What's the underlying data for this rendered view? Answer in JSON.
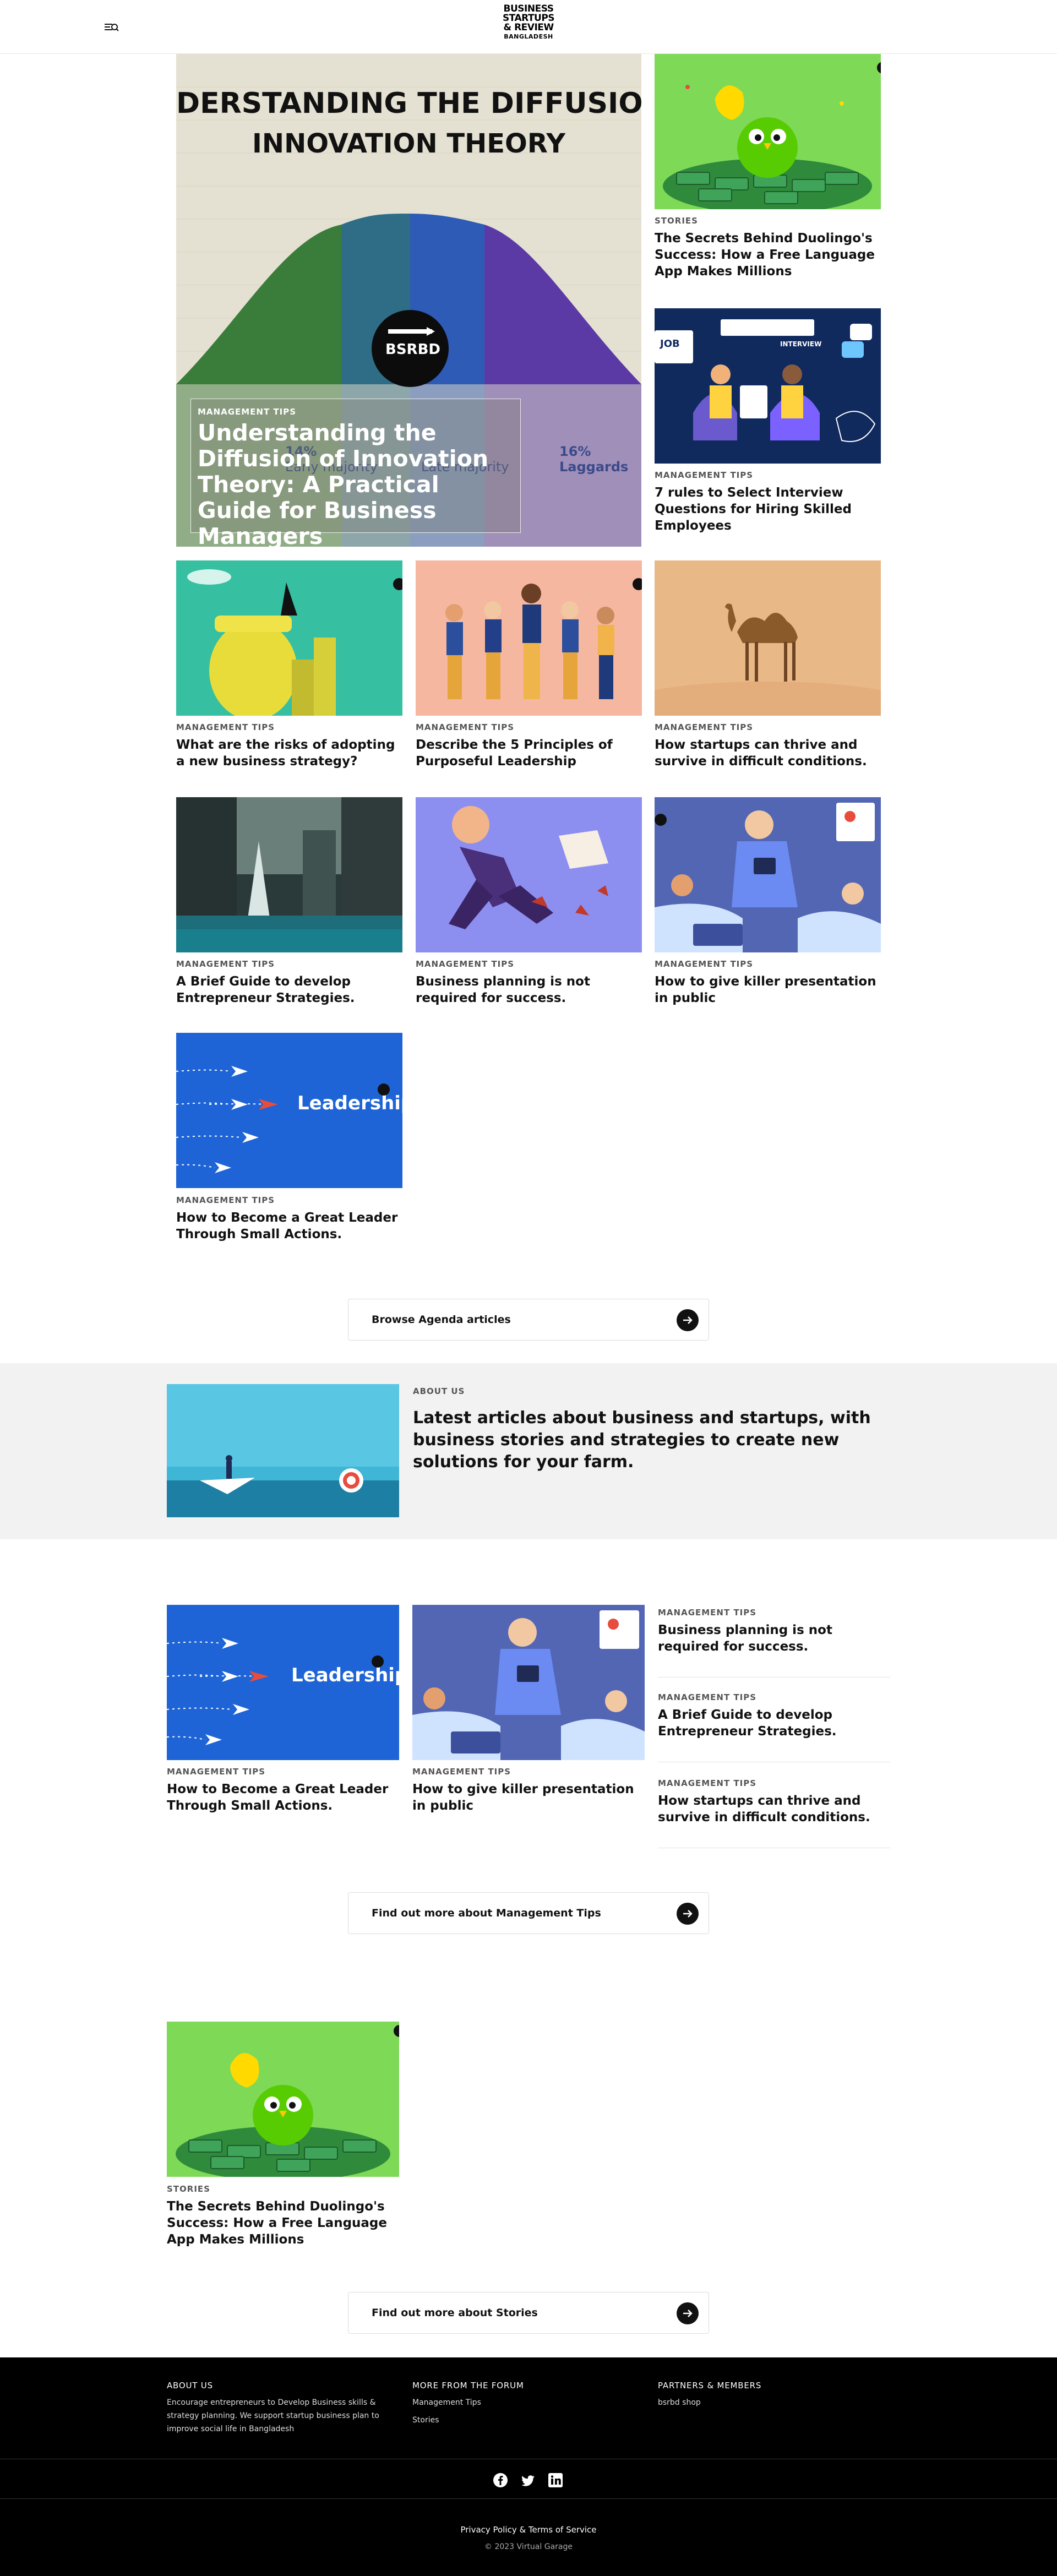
{
  "brand": {
    "logo_line1": "BUSINESS",
    "logo_line2": "STARTUPS",
    "logo_line3": "& REVIEW",
    "logo_line4": "BANGLADESH"
  },
  "hero": {
    "image_heading_line1": "DERSTANDING THE DIFFUSION O",
    "image_heading_line2": "INNOVATION THEORY",
    "badge_text": "BSRBD",
    "chart_labels": [
      "14%",
      "Early majority",
      "Late majority",
      "16%",
      "Laggards"
    ],
    "category": "MANAGEMENT TIPS",
    "title": "Understanding the Diffusion of Innovation Theory: A Practical Guide for Business Managers"
  },
  "side_articles": [
    {
      "category": "STORIES",
      "title": "The Secrets Behind Duolingo's Success: How a Free Language App Makes Millions"
    },
    {
      "category": "MANAGEMENT TIPS",
      "title": "7 rules to Select Interview Questions for Hiring Skilled Employees",
      "image_text_job": "JOB",
      "image_text_interview": "INTERVIEW"
    }
  ],
  "grid_articles": [
    {
      "category": "MANAGEMENT TIPS",
      "title": "What are the risks of adopting a new business strategy?"
    },
    {
      "category": "MANAGEMENT TIPS",
      "title": "Describe the 5 Principles of Purposeful Leadership"
    },
    {
      "category": "MANAGEMENT TIPS",
      "title": "How startups can thrive and survive in difficult conditions."
    },
    {
      "category": "MANAGEMENT TIPS",
      "title": "A Brief Guide to develop Entrepreneur Strategies."
    },
    {
      "category": "MANAGEMENT TIPS",
      "title": "Business planning is not required for success."
    },
    {
      "category": "MANAGEMENT TIPS",
      "title": "How to give killer presentation in public"
    },
    {
      "category": "MANAGEMENT TIPS",
      "title": "How to Become a Great Leader Through Small Actions.",
      "image_text": "Leadership"
    }
  ],
  "browse_button": "Browse Agenda articles",
  "about": {
    "label": "ABOUT US",
    "text": "Latest articles about business and startups, with business stories and strategies to create new solutions for your farm."
  },
  "mgmt_section": {
    "cards": [
      {
        "category": "MANAGEMENT TIPS",
        "title": "How to Become a Great Leader Through Small Actions.",
        "image_text": "Leadership"
      },
      {
        "category": "MANAGEMENT TIPS",
        "title": "How to give killer presentation in public"
      }
    ],
    "list": [
      {
        "category": "MANAGEMENT TIPS",
        "title": "Business planning is not required for success."
      },
      {
        "category": "MANAGEMENT TIPS",
        "title": "A Brief Guide to develop Entrepreneur Strategies."
      },
      {
        "category": "MANAGEMENT TIPS",
        "title": "How startups can thrive and survive in difficult conditions."
      }
    ],
    "button": "Find out more about Management Tips"
  },
  "stories_section": {
    "card": {
      "category": "STORIES",
      "title": "The Secrets Behind Duolingo's Success: How a Free Language App Makes Millions"
    },
    "button": "Find out more about Stories"
  },
  "footer": {
    "col1_heading": "ABOUT US",
    "col1_text": "Encourage entrepreneurs to Develop Business skills & strategy planning. We support startup business plan to improve social life in Bangladesh",
    "col2_heading": "MORE FROM THE FORUM",
    "col2_links": [
      "Management Tips",
      "Stories"
    ],
    "col3_heading": "PARTNERS & MEMBERS",
    "col3_links": [
      "bsrbd shop"
    ],
    "legal": "Privacy Policy & Terms of Service",
    "copyright": "© 2023 Virtual Garage"
  },
  "colors": {
    "accent_dark": "#111111",
    "about_bg": "#f2f2f2",
    "footer_bg": "#000000",
    "duolingo_green": "#7ed957",
    "leadership_blue": "#1e64d6"
  }
}
